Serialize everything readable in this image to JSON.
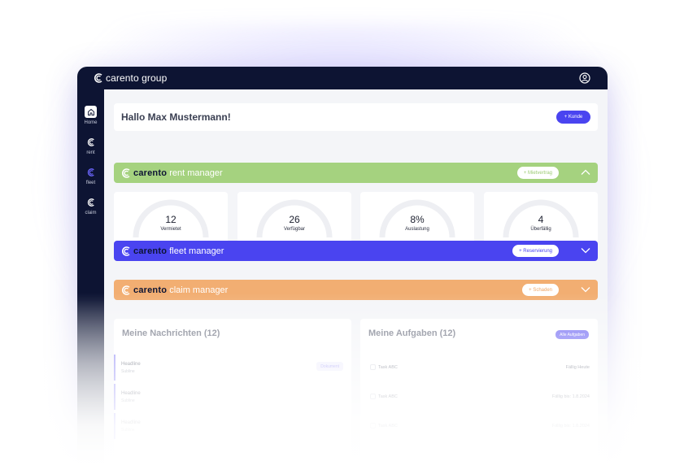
{
  "colors": {
    "navy": "#0d1433",
    "rent": "#a5d27f",
    "fleet": "#4a44f0",
    "claim": "#f2ae72",
    "accent": "#4a44f0"
  },
  "topbar": {
    "brand": "carento group",
    "user_icon": "user-circle-icon"
  },
  "sidebar": {
    "items": [
      {
        "label": "Home",
        "icon": "home-icon",
        "active": true
      },
      {
        "label": "rent",
        "icon": "carento-logo-icon"
      },
      {
        "label": "fleet",
        "icon": "carento-logo-icon"
      },
      {
        "label": "claim",
        "icon": "carento-logo-icon"
      }
    ]
  },
  "greeting": {
    "title": "Hallo Max Mustermann!",
    "button": "+ Kunde"
  },
  "rent": {
    "brand": "carento",
    "product": "rent manager",
    "button": "+ Mietvertrag",
    "stats": [
      {
        "value": "12",
        "label": "Vermietet"
      },
      {
        "value": "26",
        "label": "Verfügbar"
      },
      {
        "value": "8%",
        "label": "Auslastung"
      },
      {
        "value": "4",
        "label": "Überfällig"
      }
    ]
  },
  "fleet": {
    "brand": "carento",
    "product": "fleet manager",
    "button": "+ Reservierung"
  },
  "claim": {
    "brand": "carento",
    "product": "claim manager",
    "button": "+ Schaden"
  },
  "messages": {
    "title": "Meine Nachrichten (12)",
    "items": [
      {
        "headline": "Headline",
        "subline": "Subline",
        "tag": "Dokument"
      },
      {
        "headline": "Headline",
        "subline": "Subline"
      },
      {
        "headline": "Headline",
        "subline": "Subline"
      }
    ]
  },
  "tasks": {
    "title": "Meine Aufgaben (12)",
    "button": "Alle Aufgaben",
    "items": [
      {
        "name": "Task ABC",
        "due": "Fällig Heute"
      },
      {
        "name": "Task ABC",
        "due": "Fällig bis: 1.8.2024"
      },
      {
        "name": "Task ABC",
        "due": "Fällig bis: 1.8.2024"
      }
    ]
  }
}
